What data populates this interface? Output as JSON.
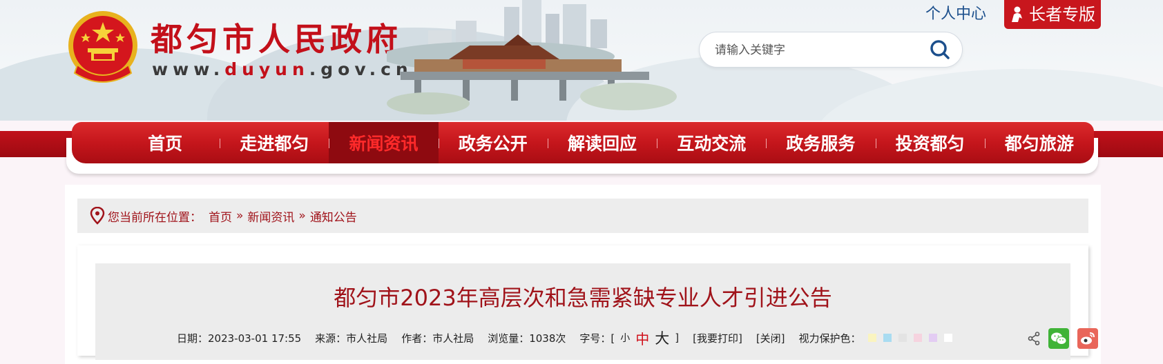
{
  "header": {
    "site_name": "都匀市人民政府",
    "url_prefix": "www.",
    "url_highlight": "duyun",
    "url_suffix": ".gov.cn",
    "personal_center": "个人中心",
    "elder_mode": "长者专版",
    "search_placeholder": "请输入关键字"
  },
  "nav": {
    "items": [
      "首页",
      "走进都匀",
      "新闻资讯",
      "政务公开",
      "解读回应",
      "互动交流",
      "政务服务",
      "投资都匀",
      "都匀旅游"
    ],
    "active_index": 2
  },
  "breadcrumb": {
    "label": "您当前所在位置：",
    "items": [
      "首页",
      "新闻资讯",
      "通知公告"
    ],
    "separator": "»"
  },
  "article": {
    "title": "都匀市2023年高层次和急需紧缺专业人才引进公告",
    "date": "日期：2023-03-01 17:55",
    "source": "来源：市人社局",
    "author": "作者：市人社局",
    "views": "浏览量：1038次",
    "font_size_label": "字号：[",
    "font_small": "小",
    "font_medium": "中",
    "font_large": "大",
    "font_close": "]",
    "print": "[我要打印]",
    "close": "[关闭]",
    "eye_care_label": "视力保护色：",
    "eye_care_colors": [
      "#faf4c0",
      "#a9dcf1",
      "#e3e3e3",
      "#f6d3df",
      "#e3ccf3",
      "#ffffff"
    ]
  },
  "share": {
    "icons": [
      "share-icon",
      "wechat-icon",
      "weibo-icon"
    ]
  },
  "colors": {
    "brand_red": "#c3101a",
    "title_red": "#a0131a",
    "nav_active_bg": "#8e0a10",
    "link_blue": "#1c4f8c"
  }
}
